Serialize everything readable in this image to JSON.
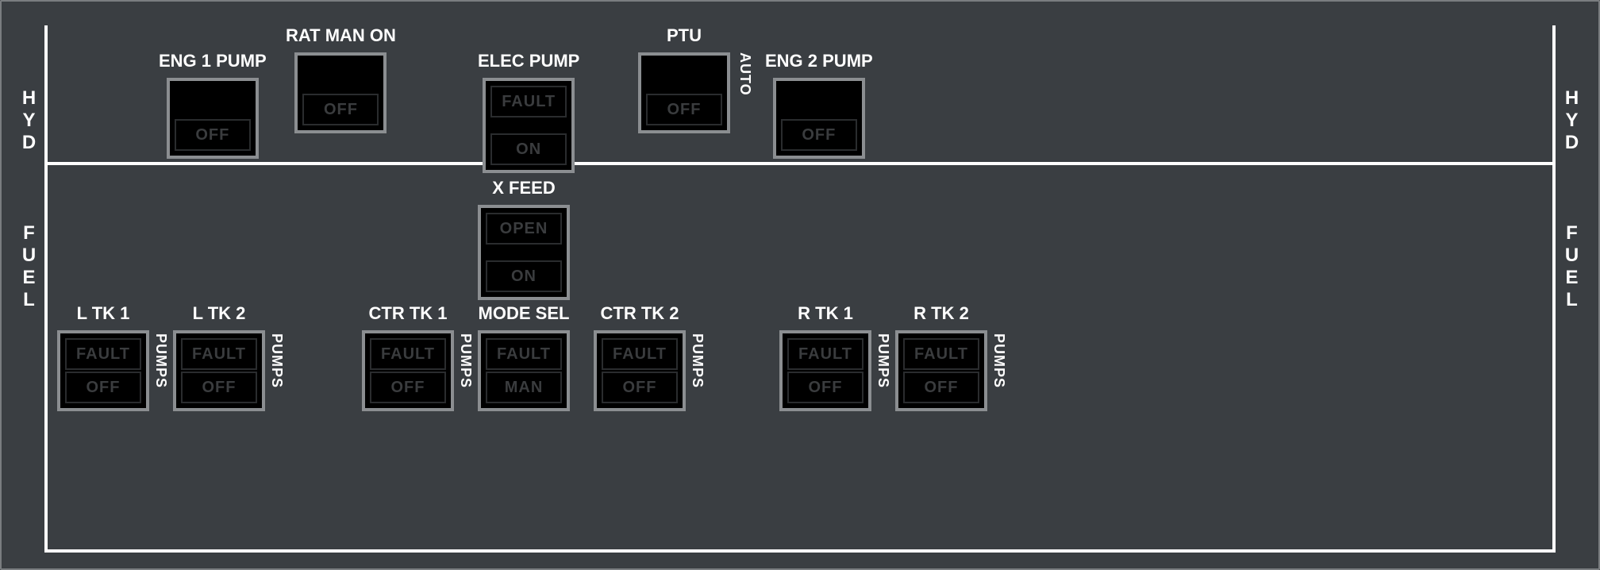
{
  "sections": {
    "hyd": "HYD",
    "fuel": "FUEL"
  },
  "side_labels": {
    "auto": "AUTO",
    "pumps": "PUMPS"
  },
  "hyd": {
    "eng1_pump": {
      "title": "ENG 1 PUMP",
      "top": "",
      "bottom": "OFF"
    },
    "rat_man_on": {
      "title": "RAT MAN ON",
      "top": "",
      "bottom": "OFF"
    },
    "elec_pump": {
      "title": "ELEC PUMP",
      "top": "FAULT",
      "bottom": "ON"
    },
    "ptu": {
      "title": "PTU",
      "top": "",
      "bottom": "OFF"
    },
    "eng2_pump": {
      "title": "ENG 2 PUMP",
      "top": "",
      "bottom": "OFF"
    }
  },
  "fuel": {
    "x_feed": {
      "title": "X FEED",
      "top": "OPEN",
      "bottom": "ON"
    },
    "l_tk_1": {
      "title": "L TK 1",
      "top": "FAULT",
      "bottom": "OFF"
    },
    "l_tk_2": {
      "title": "L TK 2",
      "top": "FAULT",
      "bottom": "OFF"
    },
    "ctr_tk_1": {
      "title": "CTR TK 1",
      "top": "FAULT",
      "bottom": "OFF"
    },
    "mode_sel": {
      "title": "MODE SEL",
      "top": "FAULT",
      "bottom": "MAN"
    },
    "ctr_tk_2": {
      "title": "CTR TK 2",
      "top": "FAULT",
      "bottom": "OFF"
    },
    "r_tk_1": {
      "title": "R TK 1",
      "top": "FAULT",
      "bottom": "OFF"
    },
    "r_tk_2": {
      "title": "R TK 2",
      "top": "FAULT",
      "bottom": "OFF"
    }
  }
}
